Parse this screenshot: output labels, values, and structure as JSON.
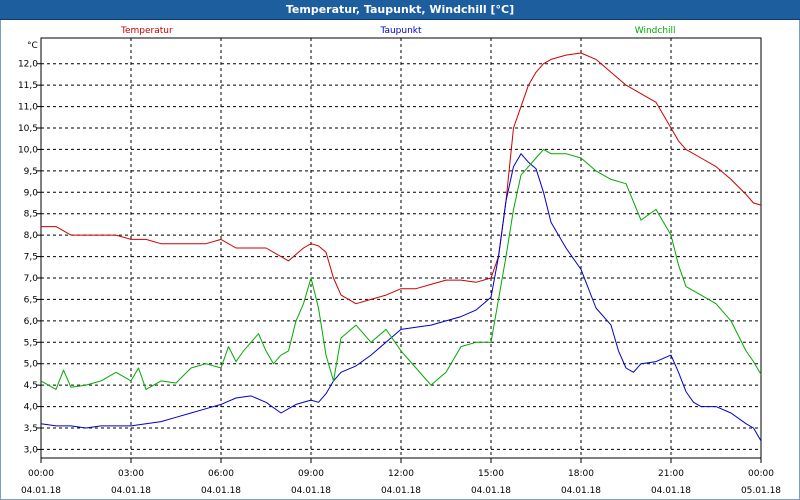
{
  "window": {
    "title": "Temperatur, Taupunkt, Windchill [°C]"
  },
  "chart_data": {
    "type": "line",
    "title": "Temperatur, Taupunkt, Windchill [°C]",
    "ylabel": "°C",
    "ylim": [
      2.8,
      12.6
    ],
    "xlim_hours": [
      0,
      24
    ],
    "grid": true,
    "legend_placement": "top",
    "y_ticks": [
      "3.0",
      "3.5",
      "4.0",
      "4.5",
      "5.0",
      "5.5",
      "6.0",
      "6.5",
      "7.0",
      "7.5",
      "8.0",
      "8.5",
      "9.0",
      "9.5",
      "10.0",
      "10.5",
      "11.0",
      "11.5",
      "12.0"
    ],
    "y_tick_labels": [
      "3,0",
      "3,5",
      "4,0",
      "4,5",
      "5,0",
      "5,5",
      "6,0",
      "6,5",
      "7,0",
      "7,5",
      "8,0",
      "8,5",
      "9,0",
      "9,5",
      "10,0",
      "10,5",
      "11,0",
      "11,5",
      "12,0"
    ],
    "x_ticks": [
      {
        "time": "00:00",
        "date": "04.01.18"
      },
      {
        "time": "03:00",
        "date": "04.01.18"
      },
      {
        "time": "06:00",
        "date": "04.01.18"
      },
      {
        "time": "09:00",
        "date": "04.01.18"
      },
      {
        "time": "12:00",
        "date": "04.01.18"
      },
      {
        "time": "15:00",
        "date": "04.01.18"
      },
      {
        "time": "18:00",
        "date": "04.01.18"
      },
      {
        "time": "21:00",
        "date": "04.01.18"
      },
      {
        "time": "00:00",
        "date": "05.01.18"
      }
    ],
    "series": [
      {
        "name": "Temperatur",
        "color": "#cc0000",
        "points": [
          [
            0.0,
            8.2
          ],
          [
            0.5,
            8.2
          ],
          [
            1.0,
            8.0
          ],
          [
            1.5,
            8.0
          ],
          [
            2.0,
            8.0
          ],
          [
            2.5,
            8.0
          ],
          [
            3.0,
            7.9
          ],
          [
            3.5,
            7.9
          ],
          [
            4.0,
            7.8
          ],
          [
            4.5,
            7.8
          ],
          [
            5.0,
            7.8
          ],
          [
            5.5,
            7.8
          ],
          [
            6.0,
            7.9
          ],
          [
            6.5,
            7.7
          ],
          [
            7.0,
            7.7
          ],
          [
            7.5,
            7.7
          ],
          [
            8.0,
            7.5
          ],
          [
            8.25,
            7.4
          ],
          [
            8.5,
            7.55
          ],
          [
            8.75,
            7.7
          ],
          [
            9.0,
            7.8
          ],
          [
            9.25,
            7.75
          ],
          [
            9.5,
            7.6
          ],
          [
            9.75,
            7.0
          ],
          [
            10.0,
            6.6
          ],
          [
            10.5,
            6.4
          ],
          [
            11.0,
            6.5
          ],
          [
            11.5,
            6.6
          ],
          [
            12.0,
            6.75
          ],
          [
            12.5,
            6.75
          ],
          [
            13.0,
            6.85
          ],
          [
            13.5,
            6.95
          ],
          [
            14.0,
            6.95
          ],
          [
            14.5,
            6.9
          ],
          [
            15.0,
            7.0
          ],
          [
            15.25,
            7.5
          ],
          [
            15.5,
            8.8
          ],
          [
            15.75,
            10.5
          ],
          [
            16.0,
            11.0
          ],
          [
            16.25,
            11.5
          ],
          [
            16.5,
            11.8
          ],
          [
            16.75,
            12.0
          ],
          [
            17.0,
            12.1
          ],
          [
            17.5,
            12.2
          ],
          [
            18.0,
            12.25
          ],
          [
            18.5,
            12.1
          ],
          [
            19.0,
            11.8
          ],
          [
            19.5,
            11.5
          ],
          [
            20.0,
            11.3
          ],
          [
            20.5,
            11.1
          ],
          [
            21.0,
            10.5
          ],
          [
            21.25,
            10.2
          ],
          [
            21.5,
            10.0
          ],
          [
            22.0,
            9.8
          ],
          [
            22.5,
            9.6
          ],
          [
            23.0,
            9.3
          ],
          [
            23.5,
            8.95
          ],
          [
            23.75,
            8.75
          ],
          [
            24.0,
            8.7
          ]
        ]
      },
      {
        "name": "Taupunkt",
        "color": "#0000cc",
        "points": [
          [
            0.0,
            3.6
          ],
          [
            0.5,
            3.55
          ],
          [
            1.0,
            3.55
          ],
          [
            1.5,
            3.5
          ],
          [
            2.0,
            3.55
          ],
          [
            2.5,
            3.55
          ],
          [
            3.0,
            3.55
          ],
          [
            3.5,
            3.6
          ],
          [
            4.0,
            3.65
          ],
          [
            4.5,
            3.75
          ],
          [
            5.0,
            3.85
          ],
          [
            5.5,
            3.95
          ],
          [
            6.0,
            4.05
          ],
          [
            6.5,
            4.2
          ],
          [
            7.0,
            4.25
          ],
          [
            7.5,
            4.1
          ],
          [
            8.0,
            3.85
          ],
          [
            8.5,
            4.05
          ],
          [
            9.0,
            4.15
          ],
          [
            9.25,
            4.1
          ],
          [
            9.5,
            4.3
          ],
          [
            9.75,
            4.6
          ],
          [
            10.0,
            4.8
          ],
          [
            10.5,
            4.95
          ],
          [
            11.0,
            5.2
          ],
          [
            11.5,
            5.5
          ],
          [
            12.0,
            5.8
          ],
          [
            12.5,
            5.85
          ],
          [
            13.0,
            5.9
          ],
          [
            13.5,
            6.0
          ],
          [
            14.0,
            6.1
          ],
          [
            14.5,
            6.25
          ],
          [
            15.0,
            6.55
          ],
          [
            15.25,
            7.5
          ],
          [
            15.5,
            8.8
          ],
          [
            15.75,
            9.6
          ],
          [
            16.0,
            9.9
          ],
          [
            16.25,
            9.7
          ],
          [
            16.5,
            9.55
          ],
          [
            16.75,
            9.0
          ],
          [
            17.0,
            8.3
          ],
          [
            17.5,
            7.7
          ],
          [
            18.0,
            7.2
          ],
          [
            18.5,
            6.3
          ],
          [
            19.0,
            5.9
          ],
          [
            19.25,
            5.3
          ],
          [
            19.5,
            4.9
          ],
          [
            19.75,
            4.8
          ],
          [
            20.0,
            5.0
          ],
          [
            20.5,
            5.05
          ],
          [
            21.0,
            5.2
          ],
          [
            21.25,
            4.8
          ],
          [
            21.5,
            4.35
          ],
          [
            21.75,
            4.1
          ],
          [
            22.0,
            4.0
          ],
          [
            22.5,
            4.0
          ],
          [
            23.0,
            3.85
          ],
          [
            23.5,
            3.6
          ],
          [
            23.75,
            3.5
          ],
          [
            24.0,
            3.2
          ]
        ]
      },
      {
        "name": "Windchill",
        "color": "#00aa00",
        "points": [
          [
            0.0,
            4.6
          ],
          [
            0.5,
            4.4
          ],
          [
            0.75,
            4.85
          ],
          [
            1.0,
            4.45
          ],
          [
            1.5,
            4.5
          ],
          [
            2.0,
            4.6
          ],
          [
            2.5,
            4.8
          ],
          [
            3.0,
            4.6
          ],
          [
            3.25,
            4.9
          ],
          [
            3.5,
            4.4
          ],
          [
            4.0,
            4.6
          ],
          [
            4.5,
            4.55
          ],
          [
            5.0,
            4.9
          ],
          [
            5.5,
            5.0
          ],
          [
            6.0,
            4.9
          ],
          [
            6.25,
            5.4
          ],
          [
            6.5,
            5.05
          ],
          [
            6.75,
            5.3
          ],
          [
            7.0,
            5.5
          ],
          [
            7.25,
            5.7
          ],
          [
            7.5,
            5.3
          ],
          [
            7.75,
            5.0
          ],
          [
            8.0,
            5.2
          ],
          [
            8.25,
            5.3
          ],
          [
            8.5,
            6.0
          ],
          [
            8.75,
            6.4
          ],
          [
            9.0,
            7.0
          ],
          [
            9.25,
            6.3
          ],
          [
            9.5,
            5.2
          ],
          [
            9.75,
            4.6
          ],
          [
            10.0,
            5.6
          ],
          [
            10.5,
            5.9
          ],
          [
            11.0,
            5.5
          ],
          [
            11.5,
            5.8
          ],
          [
            12.0,
            5.3
          ],
          [
            12.5,
            4.9
          ],
          [
            13.0,
            4.5
          ],
          [
            13.5,
            4.8
          ],
          [
            14.0,
            5.4
          ],
          [
            14.5,
            5.5
          ],
          [
            15.0,
            5.5
          ],
          [
            15.25,
            6.5
          ],
          [
            15.5,
            7.5
          ],
          [
            15.75,
            8.6
          ],
          [
            16.0,
            9.4
          ],
          [
            16.25,
            9.6
          ],
          [
            16.5,
            9.8
          ],
          [
            16.75,
            10.0
          ],
          [
            17.0,
            9.9
          ],
          [
            17.5,
            9.9
          ],
          [
            18.0,
            9.8
          ],
          [
            18.5,
            9.5
          ],
          [
            19.0,
            9.3
          ],
          [
            19.5,
            9.2
          ],
          [
            20.0,
            8.35
          ],
          [
            20.5,
            8.6
          ],
          [
            21.0,
            8.0
          ],
          [
            21.25,
            7.3
          ],
          [
            21.5,
            6.8
          ],
          [
            22.0,
            6.6
          ],
          [
            22.5,
            6.4
          ],
          [
            23.0,
            6.0
          ],
          [
            23.5,
            5.3
          ],
          [
            23.75,
            5.05
          ],
          [
            24.0,
            4.75
          ]
        ]
      }
    ]
  }
}
